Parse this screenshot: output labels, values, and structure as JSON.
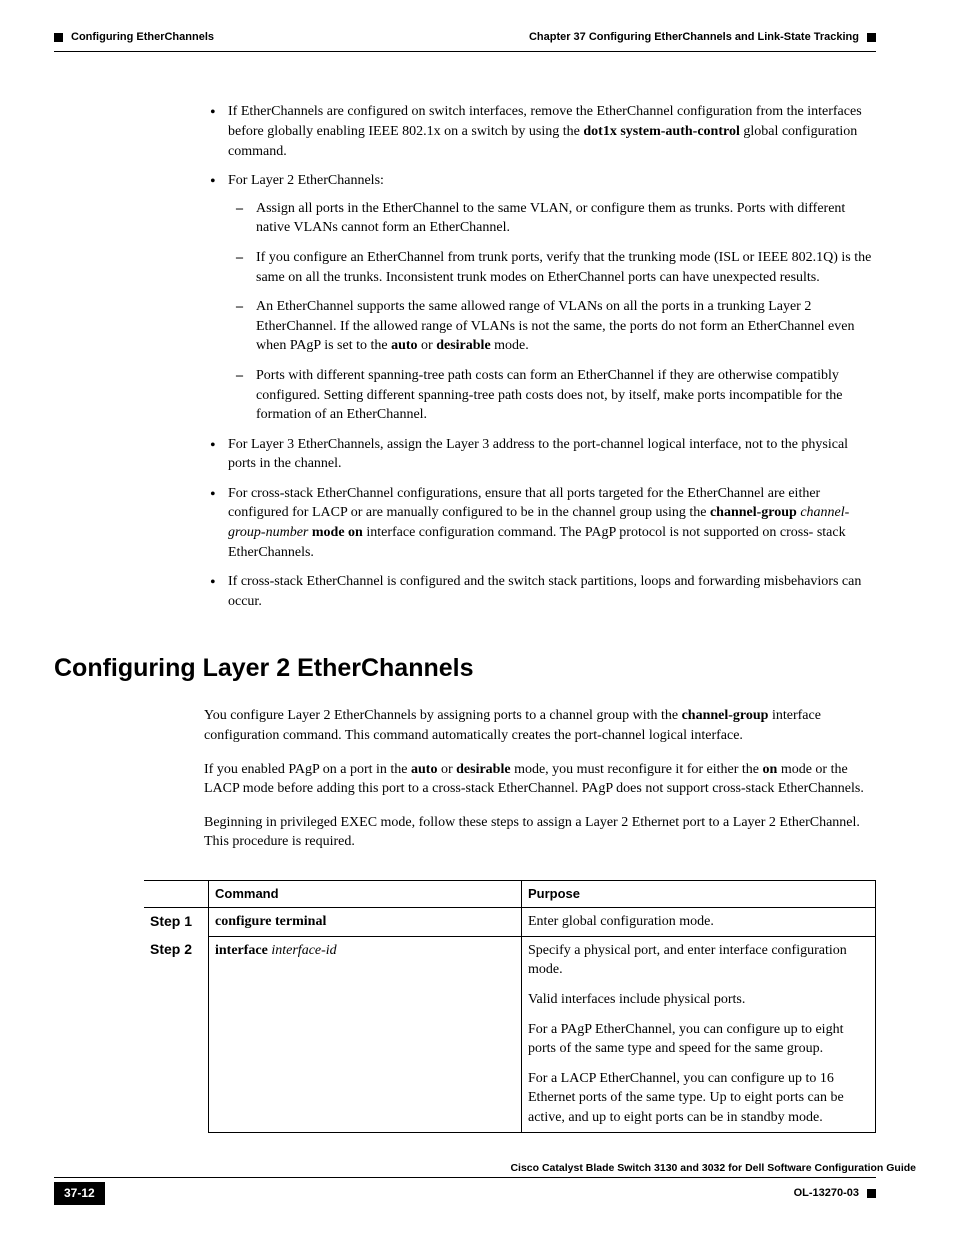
{
  "header": {
    "chapter": "Chapter 37    Configuring EtherChannels and Link-State Tracking",
    "section": "Configuring EtherChannels"
  },
  "bullets": {
    "b1_pre": "If EtherChannels are configured on switch interfaces, remove the EtherChannel configuration from the interfaces before globally enabling IEEE 802.1x on a switch by using the ",
    "b1_bold": "dot1x system-auth-control",
    "b1_post": " global configuration command.",
    "b2": "For Layer 2 EtherChannels:",
    "b2s1": "Assign all ports in the EtherChannel to the same VLAN, or configure them as trunks. Ports with different native VLANs cannot form an EtherChannel.",
    "b2s2": "If you configure an EtherChannel from trunk ports, verify that the trunking mode (ISL or IEEE 802.1Q) is the same on all the trunks. Inconsistent trunk modes on EtherChannel ports can have unexpected results.",
    "b2s3_pre": "An EtherChannel supports the same allowed range of VLANs on all the ports in a trunking Layer 2 EtherChannel. If the allowed range of VLANs is not the same, the ports do not form an EtherChannel even when PAgP is set to the ",
    "b2s3_b1": "auto",
    "b2s3_mid": " or ",
    "b2s3_b2": "desirable",
    "b2s3_post": " mode.",
    "b2s4": "Ports with different spanning-tree path costs can form an EtherChannel if they are otherwise compatibly configured. Setting different spanning-tree path costs does not, by itself, make ports incompatible for the formation of an EtherChannel.",
    "b3": "For Layer 3 EtherChannels, assign the Layer 3 address to the port-channel logical interface, not to the physical ports in the channel.",
    "b4_pre": "For cross-stack EtherChannel configurations, ensure that all ports targeted for the EtherChannel are either configured for LACP or are manually configured to be in the channel group using the ",
    "b4_b1": "channel-group",
    "b4_sp": " ",
    "b4_i": "channel-group-number",
    "b4_sp2": " ",
    "b4_b2": "mode on",
    "b4_post": " interface configuration command. The PAgP protocol is not supported on cross- stack EtherChannels.",
    "b5": "If cross-stack EtherChannel is configured and the switch stack partitions, loops and forwarding misbehaviors can occur."
  },
  "h2": "Configuring Layer 2 EtherChannels",
  "paras": {
    "p1_pre": "You configure Layer 2 EtherChannels by assigning ports to a channel group with the ",
    "p1_b": "channel-group",
    "p1_post": " interface configuration command. This command automatically creates the port-channel logical interface.",
    "p2_pre": "If you enabled PAgP on a port in the ",
    "p2_b1": "auto",
    "p2_mid1": " or ",
    "p2_b2": "desirable",
    "p2_mid2": " mode, you must reconfigure it for either the ",
    "p2_b3": "on",
    "p2_post": " mode or the LACP mode before adding this port to a cross-stack EtherChannel. PAgP does not support cross-stack EtherChannels.",
    "p3": "Beginning in privileged EXEC mode, follow these steps to assign a Layer 2 Ethernet port to a Layer 2 EtherChannel. This procedure is required."
  },
  "table": {
    "head_cmd": "Command",
    "head_purp": "Purpose",
    "r1_step": "Step 1",
    "r1_cmd": "configure terminal",
    "r1_purp": "Enter global configuration mode.",
    "r2_step": "Step 2",
    "r2_cmd_b": "interface",
    "r2_cmd_i": " interface-id",
    "r2_p1": "Specify a physical port, and enter interface configuration mode.",
    "r2_p2": "Valid interfaces include physical ports.",
    "r2_p3": "For a PAgP EtherChannel, you can configure up to eight ports of the same type and speed for the same group.",
    "r2_p4": "For a LACP EtherChannel, you can configure up to 16 Ethernet ports of the same type. Up to eight ports can be active, and up to eight ports can be in standby mode."
  },
  "footer": {
    "title": "Cisco Catalyst Blade Switch 3130 and 3032 for Dell Software Configuration Guide",
    "page": "37-12",
    "doc": "OL-13270-03"
  }
}
